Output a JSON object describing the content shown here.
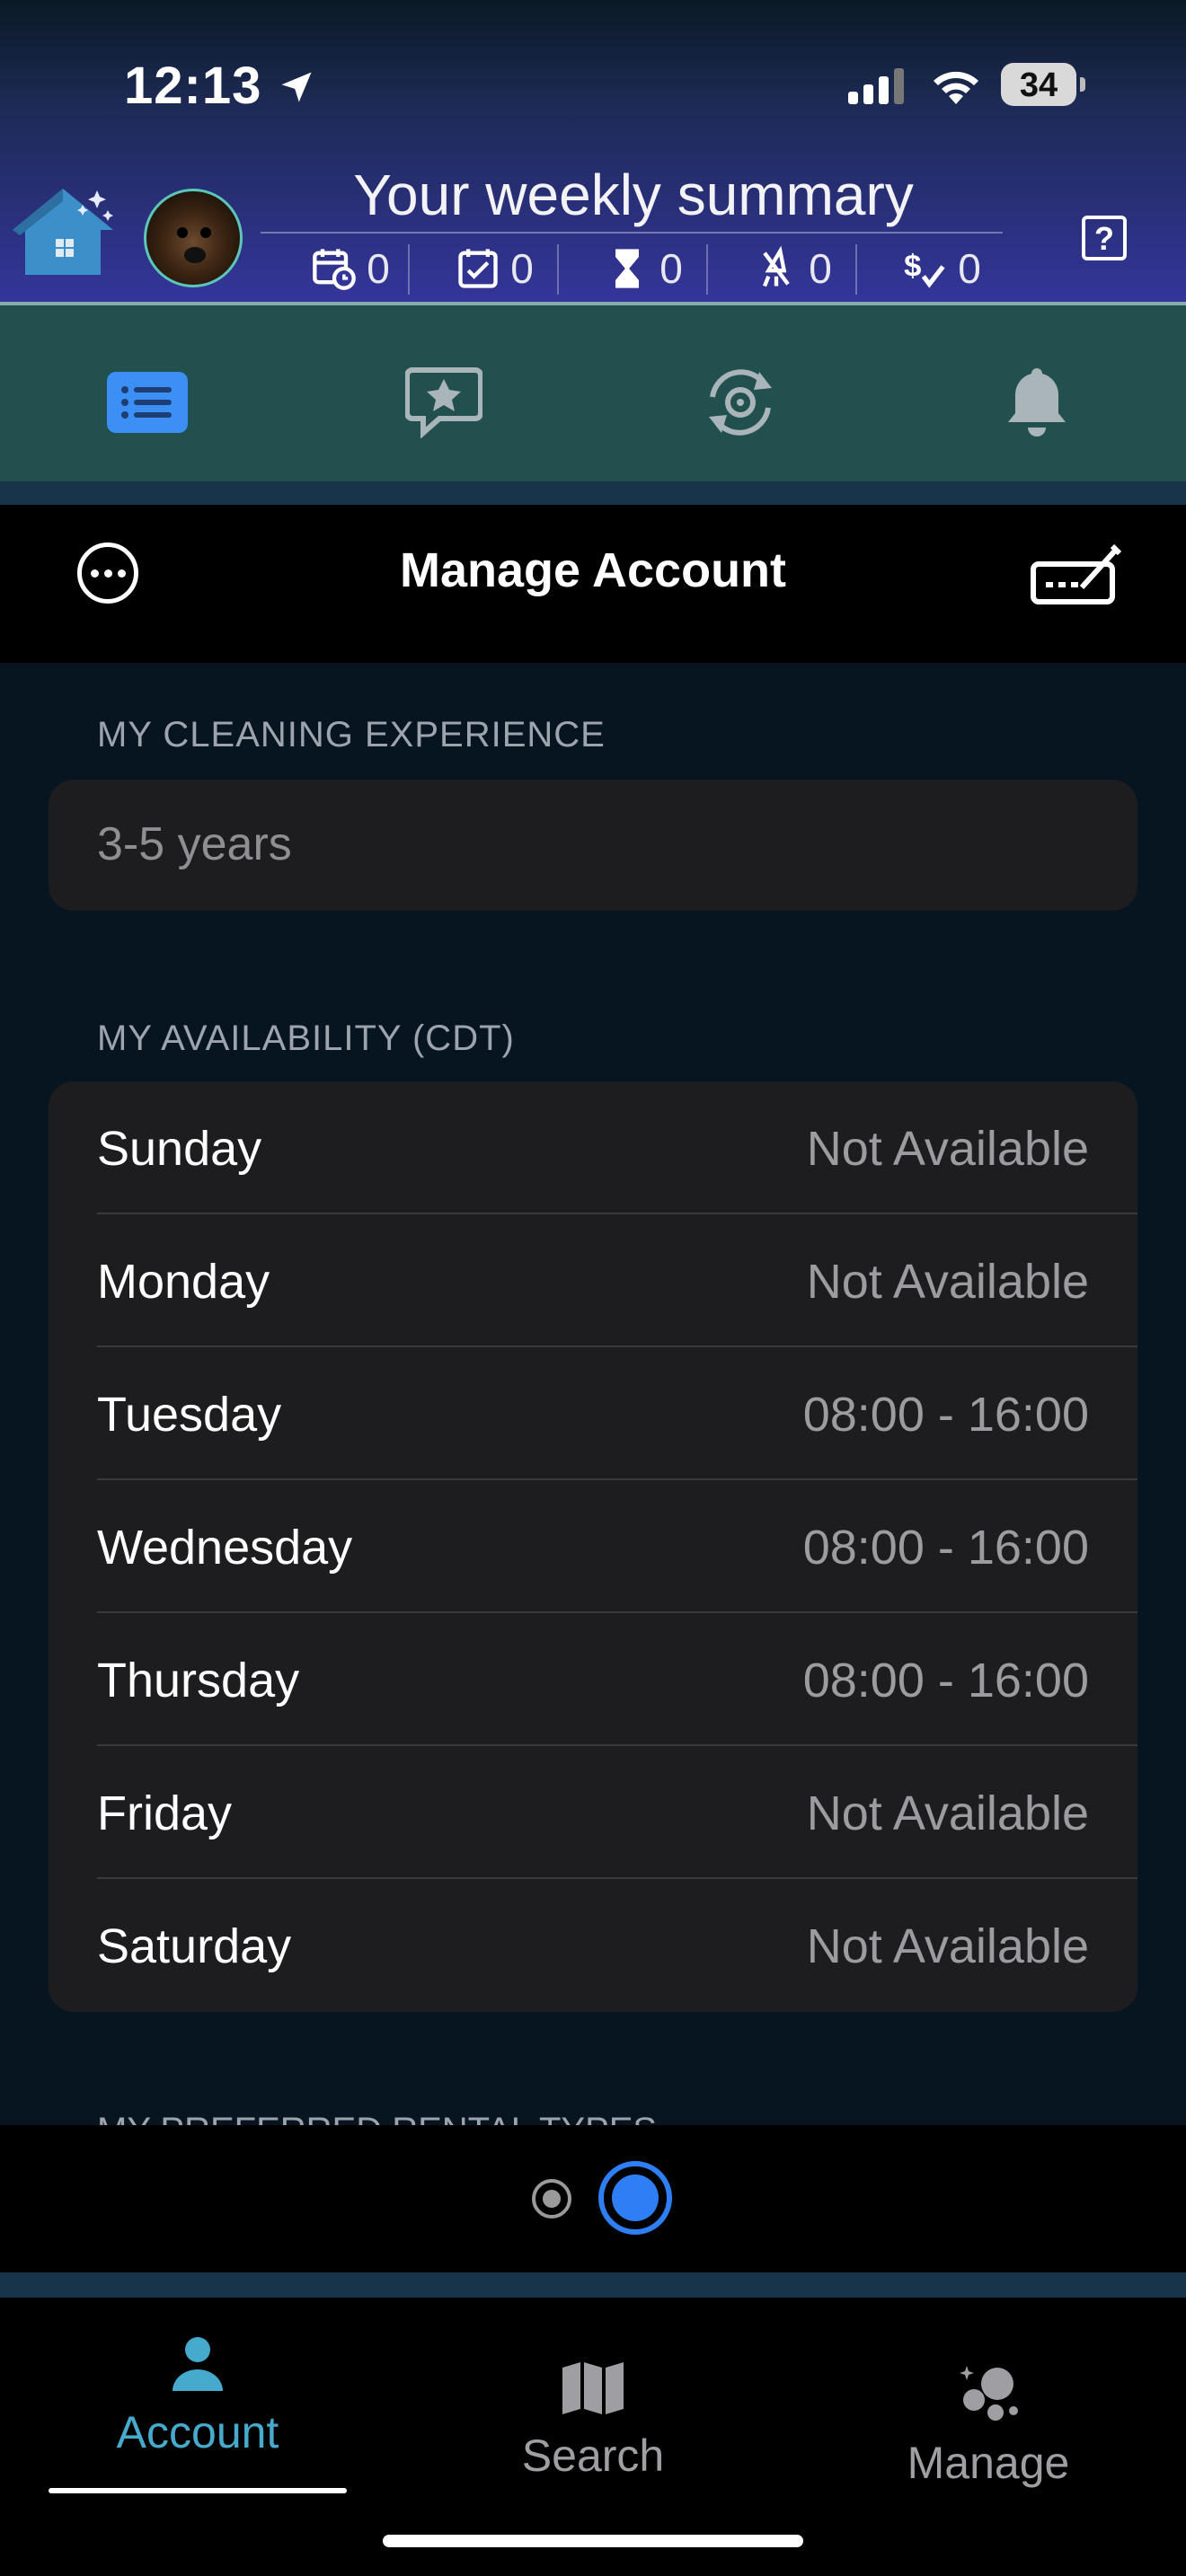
{
  "status_bar": {
    "time": "12:13",
    "battery": "34"
  },
  "header": {
    "title": "Your weekly summary",
    "stats": [
      {
        "icon": "calendar-clock-icon",
        "value": "0"
      },
      {
        "icon": "calendar-check-icon",
        "value": "0"
      },
      {
        "icon": "hourglass-icon",
        "value": "0"
      },
      {
        "icon": "no-cleaning-icon",
        "value": "0"
      },
      {
        "icon": "dollar-check-icon",
        "value": "0"
      }
    ],
    "help_label": "?"
  },
  "top_tabs": [
    {
      "icon": "list-icon",
      "active": true
    },
    {
      "icon": "review-star-icon",
      "active": false
    },
    {
      "icon": "sync-settings-icon",
      "active": false
    },
    {
      "icon": "bell-icon",
      "active": false
    }
  ],
  "nav": {
    "title": "Manage Account"
  },
  "experience": {
    "label": "MY CLEANING EXPERIENCE",
    "value": "3-5 years"
  },
  "availability": {
    "label": "MY AVAILABILITY (CDT)",
    "days": [
      {
        "day": "Sunday",
        "hours": "Not Available"
      },
      {
        "day": "Monday",
        "hours": "Not Available"
      },
      {
        "day": "Tuesday",
        "hours": "08:00 - 16:00"
      },
      {
        "day": "Wednesday",
        "hours": "08:00 - 16:00"
      },
      {
        "day": "Thursday",
        "hours": "08:00 - 16:00"
      },
      {
        "day": "Friday",
        "hours": "Not Available"
      },
      {
        "day": "Saturday",
        "hours": "Not Available"
      }
    ]
  },
  "next_section_label": "MY PREFERRED RENTAL TYPES",
  "bottom_tabs": {
    "account": "Account",
    "search": "Search",
    "manage": "Manage"
  },
  "colors": {
    "accent_blue": "#2e7ef5",
    "account_tab": "#46aacd",
    "tabbar_bg": "#22504e"
  }
}
